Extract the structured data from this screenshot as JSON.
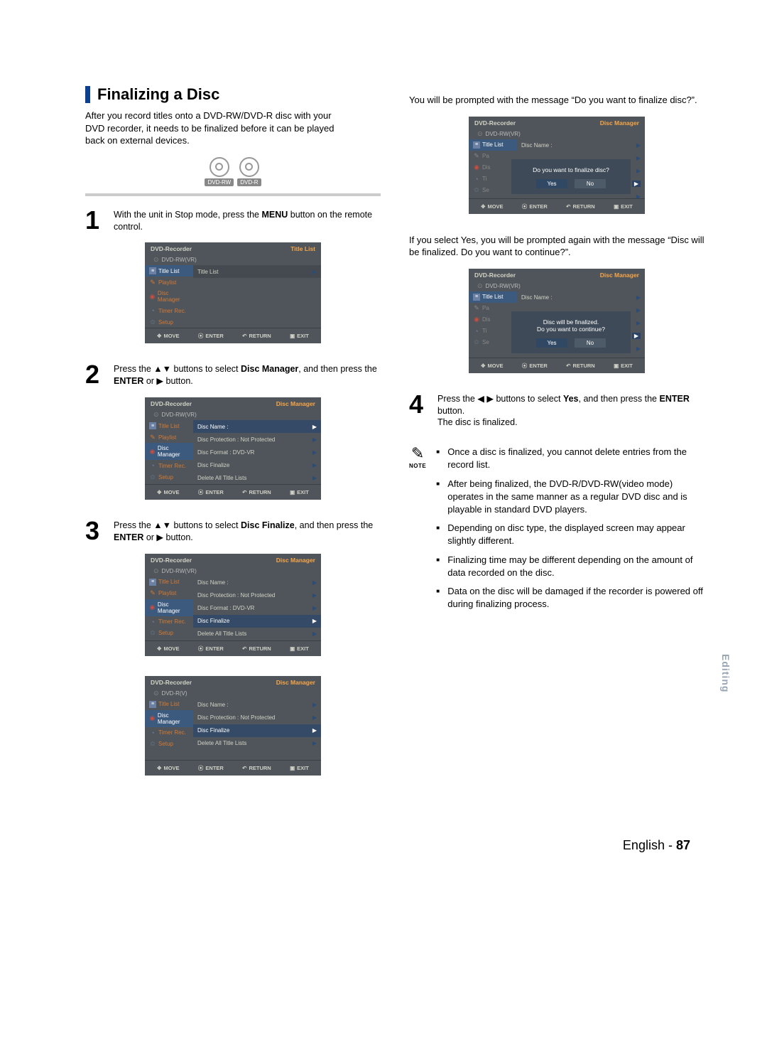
{
  "section": {
    "title": "Finalizing a Disc"
  },
  "intro": "After you record titles onto a DVD-RW/DVD-R disc with your DVD recorder, it needs to be finalized before it can be played back on external devices.",
  "disc_badges": {
    "rw": "DVD-RW",
    "r": "DVD-R"
  },
  "steps": {
    "s1_pre": "With the unit in Stop mode, press the ",
    "s1_b": "MENU",
    "s1_post": " button on the remote control.",
    "s2_pre": "Press the ▲▼ buttons to select ",
    "s2_b": "Disc Manager",
    "s2_mid": ", and then press the ",
    "s2_b2": "ENTER",
    "s2_post": " or ▶ button.",
    "s3_pre": "Press the ▲▼ buttons to select ",
    "s3_b": "Disc Finalize",
    "s3_mid": ", and then press the ",
    "s3_b2": "ENTER",
    "s3_post": " or ▶ button.",
    "s4_pre": "Press the ◀ ▶ buttons to select ",
    "s4_b": "Yes",
    "s4_mid": ", and then press the ",
    "s4_b2": "ENTER",
    "s4_post": " button.",
    "s4_line2": "The disc is finalized."
  },
  "ui_common": {
    "header_left": "DVD-Recorder",
    "header_title_list": "Title List",
    "header_disc_manager": "Disc Manager",
    "sub_rwvr": "DVD-RW(VR)",
    "sub_rv": "DVD-R(V)",
    "footer": {
      "move": "MOVE",
      "enter": "ENTER",
      "return": "RETURN",
      "exit": "EXIT"
    }
  },
  "sidebar": {
    "title_list": "Title List",
    "playlist": "Playlist",
    "disc_manager": "Disc Manager",
    "timer_rec": "Timer Rec.",
    "setup": "Setup",
    "pa": "Pa",
    "dis": "Dis",
    "ti": "Ti",
    "se": "Se"
  },
  "menu_right": {
    "title_list": "Title List",
    "disc_name": "Disc Name :",
    "disc_protection": "Disc Protection : Not Protected",
    "disc_format": "Disc Format : DVD-VR",
    "disc_finalize": "Disc Finalize",
    "delete_all": "Delete All Title Lists"
  },
  "dialog1": {
    "q": "Do you want to finalize disc?",
    "yes": "Yes",
    "no": "No"
  },
  "dialog2": {
    "l1": "Disc will be finalized.",
    "l2": "Do you want to continue?",
    "yes": "Yes",
    "no": "No"
  },
  "right_col": {
    "p1": "You will be prompted with the message “Do you want to finalize disc?”.",
    "p2": "If you select Yes, you will be prompted again with the message “Disc will be finalized. Do you want to continue?”."
  },
  "notes": {
    "label": "NOTE",
    "items": [
      "Once a disc is finalized, you cannot delete entries from the record list.",
      "After being finalized, the DVD-R/DVD-RW(video mode) operates in the same manner as   a regular DVD disc and is playable in standard DVD players.",
      "Depending on disc type, the displayed screen may appear slightly different.",
      "Finalizing time may be different depending on the amount of data recorded on the disc.",
      "Data on the disc will be damaged if the recorder is powered off during finalizing process."
    ]
  },
  "page_footer": {
    "lang": "English -",
    "num": "87"
  },
  "side_tab": "Editing"
}
